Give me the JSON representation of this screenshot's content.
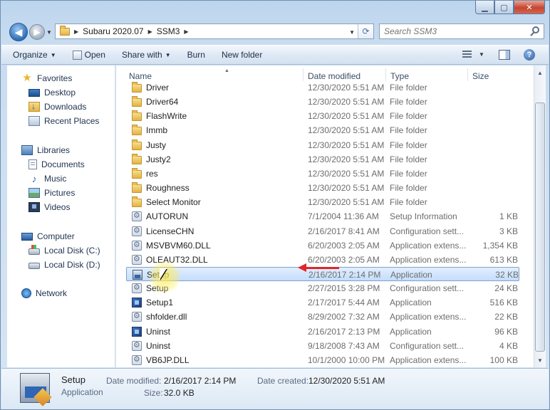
{
  "address": {
    "crumbs": [
      "Subaru 2020.07",
      "SSM3"
    ]
  },
  "search": {
    "placeholder": "Search SSM3"
  },
  "toolbar": {
    "organize": "Organize",
    "open": "Open",
    "share_with": "Share with",
    "burn": "Burn",
    "new_folder": "New folder"
  },
  "nav": {
    "favorites": "Favorites",
    "desktop": "Desktop",
    "downloads": "Downloads",
    "recent_places": "Recent Places",
    "libraries": "Libraries",
    "documents": "Documents",
    "music": "Music",
    "pictures": "Pictures",
    "videos": "Videos",
    "computer": "Computer",
    "disk_c": "Local Disk (C:)",
    "disk_d": "Local Disk (D:)",
    "network": "Network"
  },
  "columns": {
    "name": "Name",
    "date": "Date modified",
    "type": "Type",
    "size": "Size"
  },
  "files": [
    {
      "name": "Driver",
      "date": "12/30/2020 5:51 AM",
      "type": "File folder",
      "size": "",
      "icon": "folder"
    },
    {
      "name": "Driver64",
      "date": "12/30/2020 5:51 AM",
      "type": "File folder",
      "size": "",
      "icon": "folder"
    },
    {
      "name": "FlashWrite",
      "date": "12/30/2020 5:51 AM",
      "type": "File folder",
      "size": "",
      "icon": "folder"
    },
    {
      "name": "Immb",
      "date": "12/30/2020 5:51 AM",
      "type": "File folder",
      "size": "",
      "icon": "folder"
    },
    {
      "name": "Justy",
      "date": "12/30/2020 5:51 AM",
      "type": "File folder",
      "size": "",
      "icon": "folder"
    },
    {
      "name": "Justy2",
      "date": "12/30/2020 5:51 AM",
      "type": "File folder",
      "size": "",
      "icon": "folder"
    },
    {
      "name": "res",
      "date": "12/30/2020 5:51 AM",
      "type": "File folder",
      "size": "",
      "icon": "folder"
    },
    {
      "name": "Roughness",
      "date": "12/30/2020 5:51 AM",
      "type": "File folder",
      "size": "",
      "icon": "folder"
    },
    {
      "name": "Select Monitor",
      "date": "12/30/2020 5:51 AM",
      "type": "File folder",
      "size": "",
      "icon": "folder"
    },
    {
      "name": "AUTORUN",
      "date": "7/1/2004 11:36 AM",
      "type": "Setup Information",
      "size": "1 KB",
      "icon": "config"
    },
    {
      "name": "LicenseCHN",
      "date": "2/16/2017 8:41 AM",
      "type": "Configuration sett...",
      "size": "3 KB",
      "icon": "config"
    },
    {
      "name": "MSVBVM60.DLL",
      "date": "6/20/2003 2:05 AM",
      "type": "Application extens...",
      "size": "1,354 KB",
      "icon": "config"
    },
    {
      "name": "OLEAUT32.DLL",
      "date": "6/20/2003 2:05 AM",
      "type": "Application extens...",
      "size": "613 KB",
      "icon": "config"
    },
    {
      "name": "Setup",
      "date": "2/16/2017 2:14 PM",
      "type": "Application",
      "size": "32 KB",
      "icon": "installer",
      "selected": true
    },
    {
      "name": "Setup",
      "date": "2/27/2015 3:28 PM",
      "type": "Configuration sett...",
      "size": "24 KB",
      "icon": "config"
    },
    {
      "name": "Setup1",
      "date": "2/17/2017 5:44 AM",
      "type": "Application",
      "size": "516 KB",
      "icon": "app"
    },
    {
      "name": "shfolder.dll",
      "date": "8/29/2002 7:32 AM",
      "type": "Application extens...",
      "size": "22 KB",
      "icon": "config"
    },
    {
      "name": "Uninst",
      "date": "2/16/2017 2:13 PM",
      "type": "Application",
      "size": "96 KB",
      "icon": "app"
    },
    {
      "name": "Uninst",
      "date": "9/18/2008 7:43 AM",
      "type": "Configuration sett...",
      "size": "4 KB",
      "icon": "config"
    },
    {
      "name": "VB6JP.DLL",
      "date": "10/1/2000 10:00 PM",
      "type": "Application extens...",
      "size": "100 KB",
      "icon": "config"
    }
  ],
  "details": {
    "name": "Setup",
    "kind": "Application",
    "modified_label": "Date modified:",
    "modified_value": "2/16/2017 2:14 PM",
    "created_label": "Date created:",
    "created_value": "12/30/2020 5:51 AM",
    "size_label": "Size:",
    "size_value": "32.0 KB"
  }
}
